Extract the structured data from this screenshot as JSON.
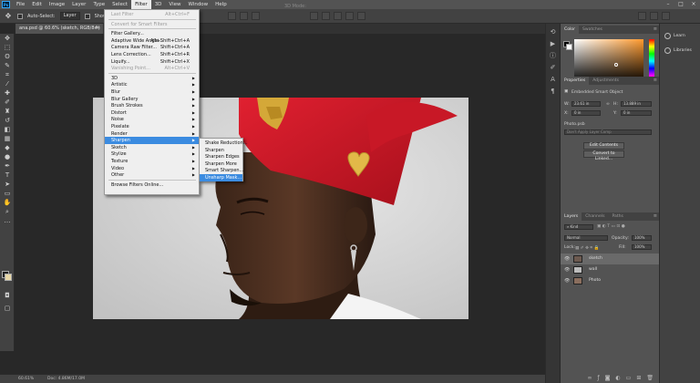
{
  "menubar": {
    "logo": "Ps",
    "items": [
      "File",
      "Edit",
      "Image",
      "Layer",
      "Type",
      "Select",
      "Filter",
      "3D",
      "View",
      "Window",
      "Help"
    ],
    "active": "Filter"
  },
  "options": {
    "auto_select_label": "Auto-Select:",
    "auto_select_value": "Layer",
    "show_transform_label": "Show Tra",
    "mode_3d": "3D Mode:"
  },
  "document": {
    "tab_title": "ana.psd @ 60.6% (sketch, RGB/8#) *",
    "zoom": "60.61%",
    "doc_info": "Doc: 4.86M/17.0M"
  },
  "filter_menu": {
    "items": [
      {
        "label": "Last Filter",
        "shortcut": "Alt+Ctrl+F",
        "disabled": true
      },
      {
        "sep": true
      },
      {
        "label": "Convert for Smart Filters",
        "disabled": true
      },
      {
        "sep": true
      },
      {
        "label": "Filter Gallery..."
      },
      {
        "label": "Adaptive Wide Angle...",
        "shortcut": "Alt+Shift+Ctrl+A"
      },
      {
        "label": "Camera Raw Filter...",
        "shortcut": "Shift+Ctrl+A"
      },
      {
        "label": "Lens Correction...",
        "shortcut": "Shift+Ctrl+R"
      },
      {
        "label": "Liquify...",
        "shortcut": "Shift+Ctrl+X"
      },
      {
        "label": "Vanishing Point...",
        "shortcut": "Alt+Ctrl+V",
        "disabled": true
      },
      {
        "sep": true
      },
      {
        "label": "3D",
        "sub": true
      },
      {
        "label": "Artistic",
        "sub": true
      },
      {
        "label": "Blur",
        "sub": true
      },
      {
        "label": "Blur Gallery",
        "sub": true
      },
      {
        "label": "Brush Strokes",
        "sub": true
      },
      {
        "label": "Distort",
        "sub": true
      },
      {
        "label": "Noise",
        "sub": true
      },
      {
        "label": "Pixelate",
        "sub": true
      },
      {
        "label": "Render",
        "sub": true
      },
      {
        "label": "Sharpen",
        "sub": true,
        "highlight": true
      },
      {
        "label": "Sketch",
        "sub": true
      },
      {
        "label": "Stylize",
        "sub": true
      },
      {
        "label": "Texture",
        "sub": true
      },
      {
        "label": "Video",
        "sub": true
      },
      {
        "label": "Other",
        "sub": true
      },
      {
        "sep": true
      },
      {
        "label": "Browse Filters Online..."
      }
    ]
  },
  "sharpen_submenu": {
    "items": [
      {
        "label": "Shake Reduction..."
      },
      {
        "label": "Sharpen"
      },
      {
        "label": "Sharpen Edges"
      },
      {
        "label": "Sharpen More"
      },
      {
        "label": "Smart Sharpen..."
      },
      {
        "label": "Unsharp Mask...",
        "highlight": true
      }
    ]
  },
  "color_panel": {
    "tabs": [
      "Color",
      "Swatches"
    ]
  },
  "properties_panel": {
    "tabs": [
      "Properties",
      "Adjustments"
    ],
    "object_type": "Embedded Smart Object",
    "w_label": "W:",
    "w_value": "23.61 in",
    "h_label": "H:",
    "h_value": "13.889 in",
    "x_label": "X:",
    "x_value": "0 in",
    "y_label": "Y:",
    "y_value": "0 in",
    "file_name": "Photo.psb",
    "layer_comp": "Don't Apply Layer Comp",
    "edit_contents": "Edit Contents",
    "convert_linked": "Convert to Linked..."
  },
  "layers_panel": {
    "tabs": [
      "Layers",
      "Channels",
      "Paths"
    ],
    "filter_kind": "Kind",
    "blend_mode": "Normal",
    "opacity_label": "Opacity:",
    "opacity_value": "100%",
    "lock_label": "Lock:",
    "fill_label": "Fill:",
    "fill_value": "100%",
    "layers": [
      {
        "name": "sketch",
        "selected": true
      },
      {
        "name": "wall",
        "selected": false
      },
      {
        "name": "Photo",
        "selected": false
      }
    ]
  },
  "right_strip": {
    "learn": "Learn",
    "libraries": "Libraries"
  }
}
